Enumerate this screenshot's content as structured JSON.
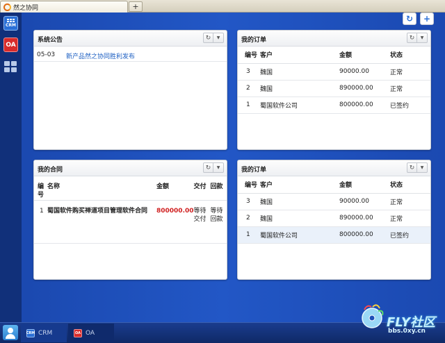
{
  "browser": {
    "tab_title": "然之协同",
    "new_tab_label": "+"
  },
  "sidebar": {
    "crm_label": "CRM",
    "oa_label": "OA"
  },
  "toolbar": {
    "refresh_glyph": "↻",
    "add_glyph": "+"
  },
  "panels": {
    "notice": {
      "title": "系统公告",
      "items": [
        {
          "date": "05-03",
          "title": "新产品然之协同胜利发布"
        }
      ]
    },
    "orders_top": {
      "title": "我的订单",
      "columns": [
        "编号",
        "客户",
        "金额",
        "状态"
      ],
      "rows": [
        {
          "id": "3",
          "customer": "魏国",
          "amount": "90000.00",
          "status": "正常"
        },
        {
          "id": "2",
          "customer": "魏国",
          "amount": "890000.00",
          "status": "正常"
        },
        {
          "id": "1",
          "customer": "蜀国软件公司",
          "amount": "800000.00",
          "status": "已签约"
        }
      ]
    },
    "contracts": {
      "title": "我的合同",
      "columns": [
        "编号",
        "名称",
        "金额",
        "交付",
        "回款"
      ],
      "rows": [
        {
          "id": "1",
          "name": "蜀国软件购买禅道项目管理软件合同",
          "amount": "800000.00",
          "delivery": "等待交付",
          "payment": "等待回款"
        }
      ]
    },
    "orders_bottom": {
      "title": "我的订单",
      "columns": [
        "编号",
        "客户",
        "金额",
        "状态"
      ],
      "rows": [
        {
          "id": "3",
          "customer": "魏国",
          "amount": "90000.00",
          "status": "正常"
        },
        {
          "id": "2",
          "customer": "魏国",
          "amount": "890000.00",
          "status": "正常"
        },
        {
          "id": "1",
          "customer": "蜀国软件公司",
          "amount": "800000.00",
          "status": "已签约"
        }
      ]
    }
  },
  "panel_buttons": {
    "refresh_glyph": "↻",
    "menu_glyph": "▼"
  },
  "taskbar": {
    "crm_label": "CRM",
    "oa_label": "OA",
    "crm_icon_label": "CRM",
    "oa_icon_label": "OA"
  },
  "watermark": {
    "text": "FLY社区",
    "sub": "bbs.0xy.cn"
  },
  "colors": {
    "background": "#1e4fb8",
    "link": "#1b5ec2",
    "amount_highlight": "#d02020"
  }
}
